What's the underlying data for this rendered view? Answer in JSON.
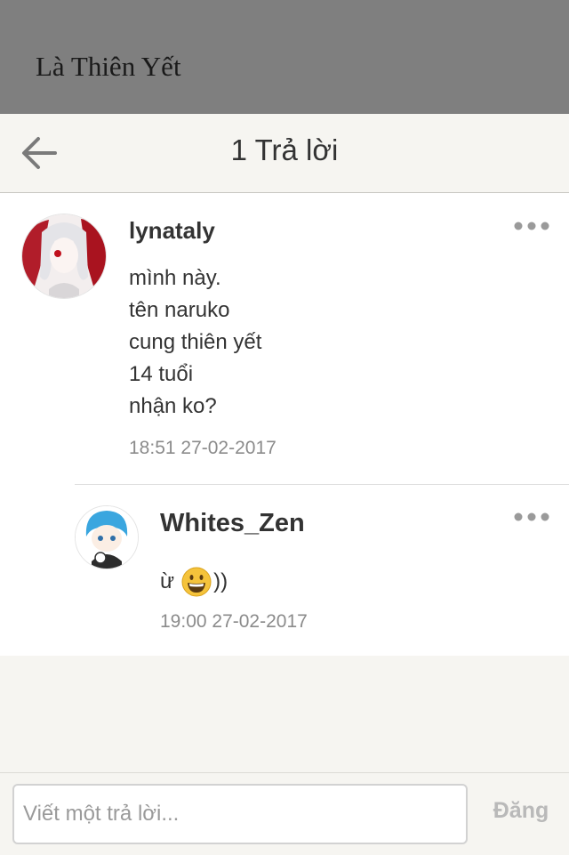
{
  "story": {
    "title": "Là Thiên Yết"
  },
  "nav": {
    "title": "1 Trả lời",
    "back_icon": "arrow-left-icon"
  },
  "comments": [
    {
      "username": "lynataly",
      "lines": [
        "mình này.",
        "tên naruko",
        "cung thiên yết",
        "14 tuổi",
        "nhận ko?"
      ],
      "timestamp": "18:51 27-02-2017"
    },
    {
      "username": "Whites_Zen",
      "text_prefix": "ừ",
      "emoji_icon": "grinning-face-icon",
      "text_suffix": "))",
      "timestamp": "19:00 27-02-2017"
    }
  ],
  "reply": {
    "placeholder": "Viết một trả lời...",
    "post_label": "Đăng"
  },
  "colors": {
    "header_bg": "#7f7f7f",
    "page_bg": "#f6f5f1",
    "muted_text": "#8b8b8b"
  }
}
